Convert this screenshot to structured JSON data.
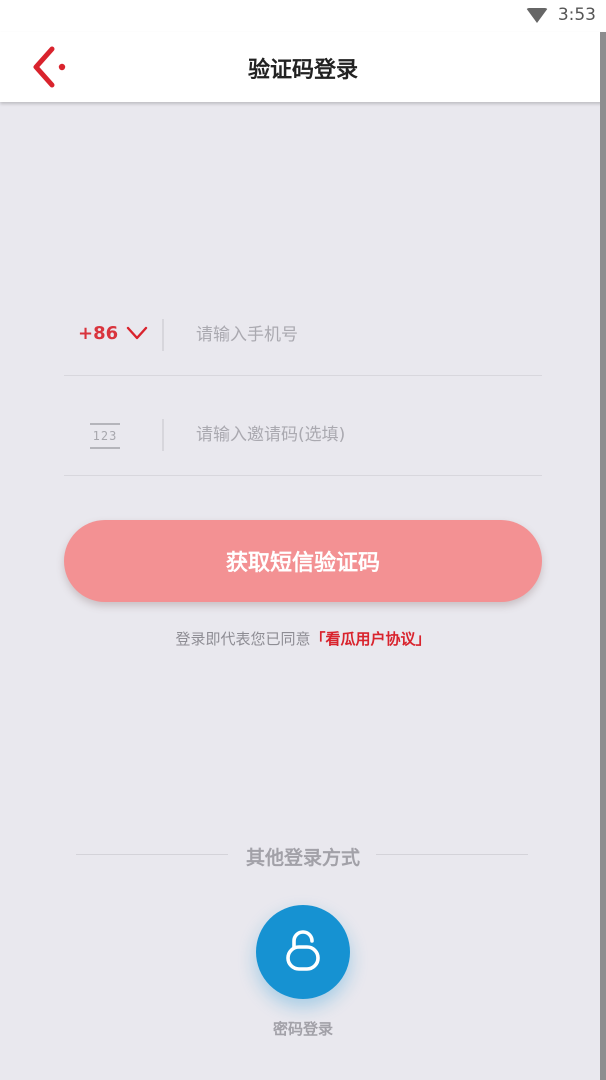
{
  "status_bar": {
    "time": "3:53",
    "icons": [
      "wifi-icon"
    ]
  },
  "header": {
    "title": "验证码登录",
    "back_icon": "back-arrow-icon",
    "accent": "#d9232d"
  },
  "form": {
    "country_code": "+86",
    "phone_placeholder": "请输入手机号",
    "invite_icon_text": "123",
    "invite_placeholder": "请输入邀请码(选填)"
  },
  "sms_button": {
    "label": "获取短信验证码",
    "color": "#f39193"
  },
  "agreement": {
    "prefix": "登录即代表您已同意",
    "link": "「看瓜用户协议」",
    "link_color": "#d9232d"
  },
  "other_login": {
    "title": "其他登录方式",
    "password_login": {
      "label": "密码登录",
      "icon": "lock-icon",
      "color": "#1692d2"
    }
  }
}
